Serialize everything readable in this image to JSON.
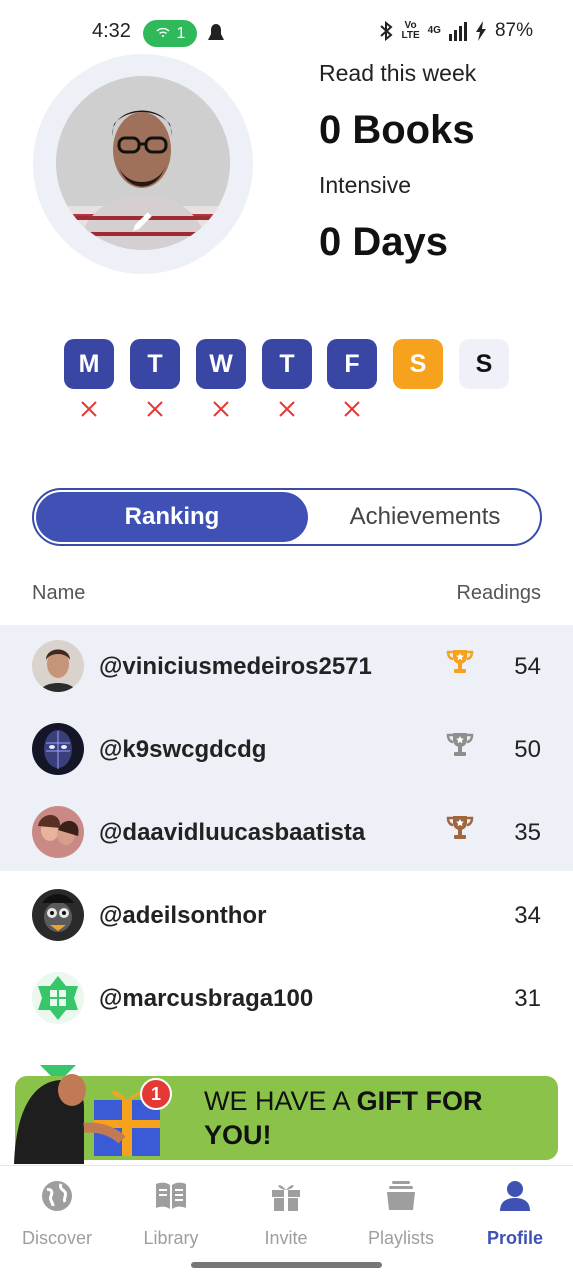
{
  "status_bar": {
    "time": "4:32",
    "hotspot_count": "1",
    "battery": "87%",
    "network_small_top": "Vo",
    "network_small_bottom": "LTE",
    "network_type": "4G"
  },
  "profile": {
    "read_label": "Read this week",
    "books_value": "0 Books",
    "intensive_label": "Intensive",
    "days_value": "0 Days"
  },
  "week": {
    "days": [
      {
        "letter": "M",
        "state": "missed"
      },
      {
        "letter": "T",
        "state": "missed"
      },
      {
        "letter": "W",
        "state": "missed"
      },
      {
        "letter": "T",
        "state": "missed"
      },
      {
        "letter": "F",
        "state": "missed"
      },
      {
        "letter": "S",
        "state": "today"
      },
      {
        "letter": "S",
        "state": "upcoming"
      }
    ]
  },
  "tabs": {
    "ranking": "Ranking",
    "achievements": "Achievements"
  },
  "table": {
    "name_header": "Name",
    "readings_header": "Readings",
    "rows": [
      {
        "username": "@viniciusmedeiros2571",
        "readings": "54",
        "trophy": "gold-trophy-icon"
      },
      {
        "username": "@k9swcgdcdg",
        "readings": "50",
        "trophy": "silver-trophy-icon"
      },
      {
        "username": "@daavidluucasbaatista",
        "readings": "35",
        "trophy": "bronze-trophy-icon"
      },
      {
        "username": "@adeilsonthor",
        "readings": "34"
      },
      {
        "username": "@marcusbraga100",
        "readings": "31"
      }
    ]
  },
  "gift": {
    "text_normal": "WE HAVE A ",
    "text_bold": "GIFT FOR YOU!",
    "badge_count": "1"
  },
  "nav": {
    "items": [
      {
        "label": "Discover",
        "icon": "globe-icon"
      },
      {
        "label": "Library",
        "icon": "book-icon"
      },
      {
        "label": "Invite",
        "icon": "gift-icon"
      },
      {
        "label": "Playlists",
        "icon": "stack-icon"
      },
      {
        "label": "Profile",
        "icon": "person-icon",
        "active": true
      }
    ]
  },
  "colors": {
    "primary": "#3f51b5",
    "day_done": "#3a46a3",
    "today": "#f6a21d",
    "gift_banner": "#8bc34a",
    "miss_mark": "#e53935"
  }
}
